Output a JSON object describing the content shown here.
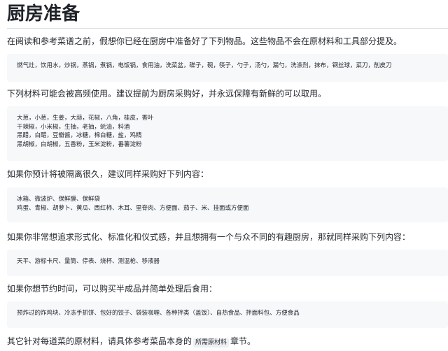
{
  "heading": "厨房准备",
  "sections": [
    {
      "intro": "在阅读和参考菜谱之前，假想你已经在厨房中准备好了下列物品。这些物品不会在原材料和工具部分提及。",
      "lines": [
        "燃气灶，饮用水，炒锅，蒸锅，煮锅，电饭锅，食用油，洗菜盆，碟子，碗，筷子，勺子，汤勺，漏勺，洗涤剂，抹布，钢丝球，菜刀，削皮刀"
      ]
    },
    {
      "intro": "下列材料可能会被高频使用。建议提前为厨房采购好，并永远保障有新鲜的可以取用。",
      "lines": [
        "大葱，小葱，生姜，大蒜，花椒，八角，桂皮，香叶",
        "干辣椒，小米椒，生抽，老抽，蚝油，料酒",
        "黑醋，白醋，豆瓣酱，冰糖，棉白糖，盐，鸡精",
        "黑胡椒，白胡椒，五香粉，玉米淀粉，番薯淀粉"
      ]
    },
    {
      "intro": "如果你预计将被隔离很久，建议同样采购好下列内容：",
      "lines": [
        "冰箱、微波炉、保鲜膜、保鲜袋",
        "鸡蛋、青椒、胡萝卜、黄瓜、西红柿、木耳、里脊肉、方便面、茄子、米、挂面或方便面"
      ]
    },
    {
      "intro": "如果你非常想追求形式化、标准化和仪式感，并且想拥有一个与众不同的有趣厨房，那就同样采购下列内容：",
      "lines": [
        "天平、游标卡尺、量筒、停表、烧杯、测温枪、移液器"
      ]
    },
    {
      "intro": "如果你想节约时间，可以购买半成品并简单处理后食用：",
      "lines": [
        "预炸过的炸鸡块、冷冻手抓饼、包好的饺子、袋装咖喱、各种拌类（盖饭）、自热食品、拌面料包、方便食品"
      ]
    }
  ],
  "footer": {
    "before": "其它针对每道菜的原材料，请具体参考菜品本身的",
    "code": "所需原材料",
    "after": "章节。"
  }
}
